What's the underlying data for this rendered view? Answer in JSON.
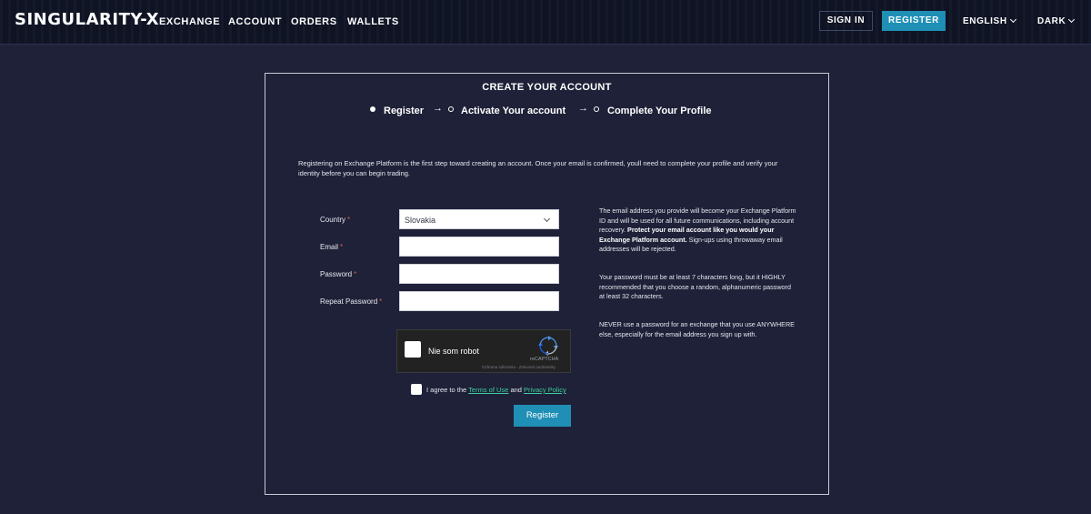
{
  "nav": {
    "logo": "SINGULARITY-X",
    "links": [
      "EXCHANGE",
      "ACCOUNT",
      "ORDERS",
      "WALLETS"
    ],
    "sign_in": "SIGN IN",
    "register": "REGISTER",
    "language": "ENGLISH",
    "theme": "DARK"
  },
  "card": {
    "title": "CREATE YOUR ACCOUNT",
    "steps": [
      {
        "label": "Register",
        "state": "active"
      },
      {
        "label": "Activate Your account",
        "state": "inactive"
      },
      {
        "label": "Complete Your Profile",
        "state": "inactive"
      }
    ],
    "step_arrow": "→",
    "intro": "Registering on Exchange Platform is the first step toward creating an account. Once your email is confirmed, youll need to complete your profile and verify your identity before you can begin trading."
  },
  "form": {
    "country_label": "Country",
    "country_value": "Slovakia",
    "email_label": "Email",
    "password_label": "Password",
    "repeat_password_label": "Repeat Password",
    "required_mark": "*",
    "captcha_label": "Nie som robot",
    "captcha_brand": "reCAPTCHA",
    "captcha_links": "Ochrana súkromia - Zmluvné podmienky",
    "agree_prefix": "I agree to the",
    "terms_link": "Terms of Use",
    "agree_and": "and",
    "privacy_link": "Privacy Policy",
    "submit": "Register"
  },
  "notes": {
    "email_note_1": "The email address you provide will become your Exchange Platform ID and will be used for all future communications, including account recovery.",
    "email_note_bold": "Protect your email account like you would your Exchange Platform account.",
    "email_note_2": "Sign-ups using throwaway email addresses will be rejected.",
    "password_note": "Your password must be at least 7 characters long, but it HIGHLY recommended that you choose a random, alphanumeric password at least 32 characters.",
    "reuse_note": "NEVER use a password for an exchange that you use ANYWHERE else, especially for the email address you sign up with."
  },
  "colors": {
    "background": "#1e2138",
    "nav_background": "#0f1322",
    "accent": "#1f8fb6",
    "link": "#3ccf9b",
    "required": "#e05a5a"
  }
}
